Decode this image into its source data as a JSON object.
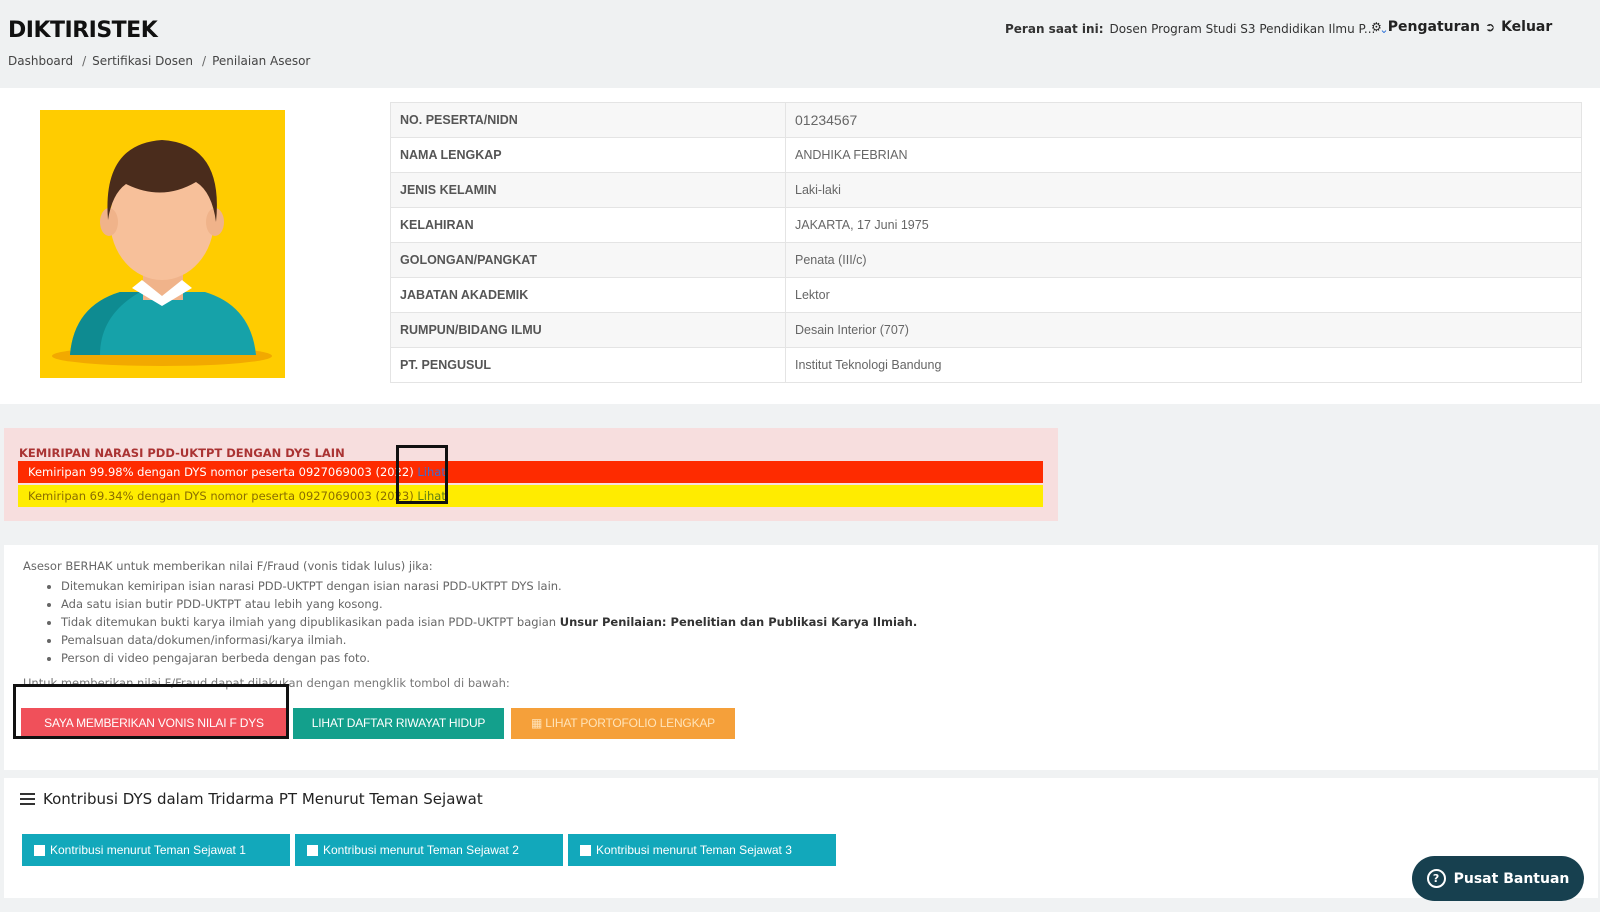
{
  "header": {
    "app_title": "DIKTIRISTEK",
    "breadcrumb": [
      "Dashboard",
      "Sertifikasi Dosen",
      "Penilaian Asesor"
    ],
    "role_label": "Peran saat ini:",
    "role_value": "Dosen Program Studi S3 Pendidikan Ilmu P...",
    "settings_label": "Pengaturan",
    "logout_label": "Keluar"
  },
  "profile": {
    "rows": [
      {
        "label": "NO. PESERTA/NIDN",
        "value": "01234567"
      },
      {
        "label": "NAMA LENGKAP",
        "value": "ANDHIKA FEBRIAN"
      },
      {
        "label": "JENIS KELAMIN",
        "value": "Laki-laki"
      },
      {
        "label": "KELAHIRAN",
        "value": "JAKARTA, 17 Juni 1975"
      },
      {
        "label": "GOLONGAN/PANGKAT",
        "value": "Penata (III/c)"
      },
      {
        "label": "JABATAN AKADEMIK",
        "value": "Lektor"
      },
      {
        "label": "RUMPUN/BIDANG ILMU",
        "value": "Desain Interior (707)"
      },
      {
        "label": "PT. PENGUSUL",
        "value": "Institut Teknologi Bandung"
      }
    ]
  },
  "similarity": {
    "title": "KEMIRIPAN NARASI PDD-UKTPT DENGAN DYS LAIN",
    "rows": [
      {
        "text": "Kemiripan 99.98% dengan DYS nomor peserta 0927069003 (2022)",
        "link": "Lihat",
        "color": "#fe2b00"
      },
      {
        "text": "Kemiripan 69.34% dengan DYS nomor peserta 0927069003 (2023)",
        "link": "Lihat",
        "color": "#ffec00"
      }
    ]
  },
  "verdict": {
    "intro": "Asesor BERHAK untuk memberikan nilai F/Fraud (vonis tidak lulus) jika:",
    "items": [
      "Ditemukan kemiripan isian narasi PDD-UKTPT dengan isian narasi PDD-UKTPT DYS lain.",
      "Ada satu isian butir PDD-UKTPT atau lebih yang kosong.",
      "Pemalsuan data/dokumen/informasi/karya ilmiah.",
      "Person di video pengajaran berbeda dengan pas foto."
    ],
    "item3_prefix": "Tidak ditemukan bukti karya ilmiah yang dipublikasikan pada isian PDD-UKTPT bagian",
    "item3_bold": "Unsur Penilaian: Penelitian dan Publikasi Karya Ilmiah.",
    "instruction": "Untuk memberikan nilai F/Fraud dapat dilakukan dengan mengklik tombol di bawah:",
    "btn_fraud": "SAYA MEMBERIKAN VONIS NILAI F DYS",
    "btn_cv": "LIHAT DAFTAR RIWAYAT HIDUP",
    "btn_portfolio": "LIHAT PORTOFOLIO LENGKAP"
  },
  "contribution": {
    "title": "Kontribusi DYS dalam Tridarma PT Menurut Teman Sejawat",
    "buttons": [
      "Kontribusi menurut Teman Sejawat 1",
      "Kontribusi menurut Teman Sejawat 2",
      "Kontribusi menurut Teman Sejawat 3"
    ]
  },
  "help_label": "Pusat Bantuan",
  "colors": {
    "accent_teal": "#13a08c",
    "fraud_red": "#f0505a",
    "contrib_blue": "#12a8bb",
    "help_dark": "#17404f",
    "photo_bg": "#ffcc00"
  },
  "icons": [
    "gear-icon",
    "logout-icon",
    "chevron-down-icon",
    "list-icon",
    "help-icon",
    "avatar"
  ]
}
